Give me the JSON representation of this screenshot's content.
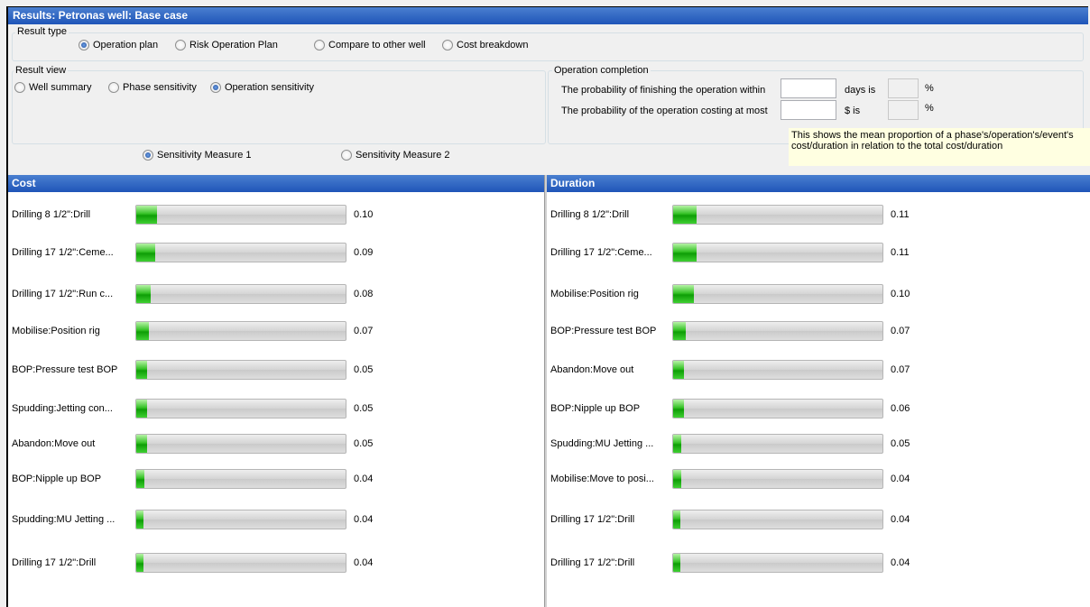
{
  "window": {
    "title": "Results: Petronas well: Base case"
  },
  "result_type": {
    "legend": "Result type",
    "options": [
      {
        "label": "Operation plan",
        "selected": true
      },
      {
        "label": "Risk Operation Plan",
        "selected": false
      },
      {
        "label": "Compare to other well",
        "selected": false
      },
      {
        "label": "Cost breakdown",
        "selected": false
      }
    ]
  },
  "result_view": {
    "legend": "Result view",
    "options": [
      {
        "label": "Well summary",
        "selected": false
      },
      {
        "label": "Phase sensitivity",
        "selected": false
      },
      {
        "label": "Operation sensitivity",
        "selected": true
      }
    ]
  },
  "operation_completion": {
    "legend": "Operation completion",
    "row1": {
      "label": "The probability of finishing the operation within",
      "value": "",
      "unit": "days is",
      "result": "",
      "percent": "%"
    },
    "row2": {
      "label": "The probability of the operation costing at most",
      "value": "",
      "unit": "$ is",
      "result": "",
      "percent": "%"
    }
  },
  "sensitivity": {
    "options": [
      {
        "label": "Sensitivity Measure 1",
        "selected": true
      },
      {
        "label": "Sensitivity Measure 2",
        "selected": false
      }
    ],
    "info": "This shows the mean proportion of a phase's/operation's/event's cost/duration in relation to the total cost/duration"
  },
  "cost": {
    "header": "Cost",
    "rows": [
      {
        "label": "Drilling 8 1/2\":Drill",
        "value": "0.10",
        "fraction": 0.1
      },
      {
        "label": "Drilling 17 1/2\":Ceme...",
        "value": "0.09",
        "fraction": 0.09
      },
      {
        "label": "Drilling 17 1/2\":Run c...",
        "value": "0.08",
        "fraction": 0.07
      },
      {
        "label": "Mobilise:Position rig",
        "value": "0.07",
        "fraction": 0.06
      },
      {
        "label": "BOP:Pressure test BOP",
        "value": "0.05",
        "fraction": 0.05
      },
      {
        "label": "Spudding:Jetting con...",
        "value": "0.05",
        "fraction": 0.05
      },
      {
        "label": "Abandon:Move out",
        "value": "0.05",
        "fraction": 0.05
      },
      {
        "label": "BOP:Nipple up BOP",
        "value": "0.04",
        "fraction": 0.04
      },
      {
        "label": "Spudding:MU Jetting ...",
        "value": "0.04",
        "fraction": 0.035
      },
      {
        "label": "Drilling 17 1/2\":Drill",
        "value": "0.04",
        "fraction": 0.035
      }
    ]
  },
  "duration": {
    "header": "Duration",
    "rows": [
      {
        "label": "Drilling 8 1/2\":Drill",
        "value": "0.11",
        "fraction": 0.11
      },
      {
        "label": "Drilling 17 1/2\":Ceme...",
        "value": "0.11",
        "fraction": 0.11
      },
      {
        "label": "Mobilise:Position rig",
        "value": "0.10",
        "fraction": 0.1
      },
      {
        "label": "BOP:Pressure test BOP",
        "value": "0.07",
        "fraction": 0.06
      },
      {
        "label": "Abandon:Move out",
        "value": "0.07",
        "fraction": 0.05
      },
      {
        "label": "BOP:Nipple up BOP",
        "value": "0.06",
        "fraction": 0.05
      },
      {
        "label": "Spudding:MU Jetting ...",
        "value": "0.05",
        "fraction": 0.04
      },
      {
        "label": "Mobilise:Move to posi...",
        "value": "0.04",
        "fraction": 0.04
      },
      {
        "label": "Drilling 17 1/2\":Drill",
        "value": "0.04",
        "fraction": 0.035
      },
      {
        "label": "Drilling 17 1/2\":Drill",
        "value": "0.04",
        "fraction": 0.035
      }
    ]
  }
}
